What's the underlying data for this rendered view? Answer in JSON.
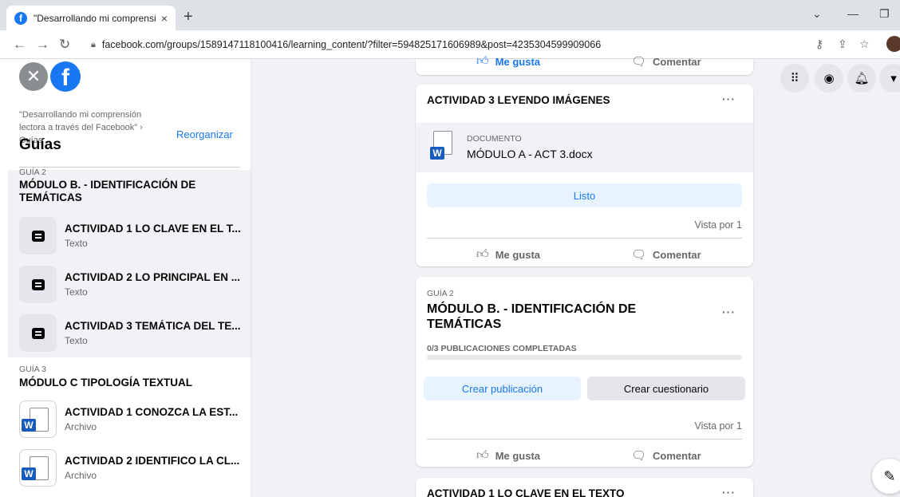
{
  "browser": {
    "tab_title": "\"Desarrollando mi comprensión",
    "tab_favicon": "f",
    "tab_close": "×",
    "new_tab": "+",
    "url": "facebook.com/groups/1589147118100416/learning_content/?filter=594825171606989&post=4235304599909066"
  },
  "sidebar": {
    "breadcrumb": "\"Desarrollando mi comprensión lectora a través del Facebook\" › Guías",
    "reorganize": "Reorganizar",
    "title": "Guías",
    "guides": [
      {
        "number": "GUÍA 2",
        "name": "MÓDULO B. - IDENTIFICACIÓN DE TEMÁTICAS",
        "items": [
          {
            "title": "ACTIVIDAD 1 LO CLAVE EN EL T...",
            "type": "Texto"
          },
          {
            "title": "ACTIVIDAD 2 LO PRINCIPAL EN ...",
            "type": "Texto"
          },
          {
            "title": "ACTIVIDAD 3 TEMÁTICA DEL TE...",
            "type": "Texto"
          }
        ]
      },
      {
        "number": "GUÍA 3",
        "name": "MÓDULO C TIPOLOGÍA TEXTUAL",
        "items": [
          {
            "title": "ACTIVIDAD 1 CONOZCA LA EST...",
            "type": "Archivo"
          },
          {
            "title": "ACTIVIDAD 2 IDENTIFICO LA CL...",
            "type": "Archivo"
          }
        ]
      }
    ]
  },
  "feed": {
    "top_actions": {
      "like": "Me gusta",
      "comment": "Comentar"
    },
    "card1": {
      "title": "ACTIVIDAD 3 LEYENDO IMÁGENES",
      "more": "···",
      "attachment_label": "DOCUMENTO",
      "attachment_name": "MÓDULO A - ACT 3.docx",
      "done": "Listo",
      "views": "Vista por 1",
      "like": "Me gusta",
      "comment": "Comentar"
    },
    "card2": {
      "guide_number": "GUÍA 2",
      "title": "MÓDULO B. - IDENTIFICACIÓN DE TEMÁTICAS",
      "more": "···",
      "progress_text": "0/3 PUBLICACIONES COMPLETADAS",
      "progress": 0,
      "create_post": "Crear publicación",
      "create_quiz": "Crear cuestionario",
      "views": "Vista por 1",
      "like": "Me gusta",
      "comment": "Comentar"
    },
    "card3": {
      "title": "ACTIVIDAD 1 LO CLAVE EN EL TEXTO",
      "more": "···"
    }
  },
  "colors": {
    "facebook_blue": "#1877f2",
    "word_blue": "#185abd",
    "light_blue": "#e7f3ff",
    "background": "#f0f2f5"
  }
}
